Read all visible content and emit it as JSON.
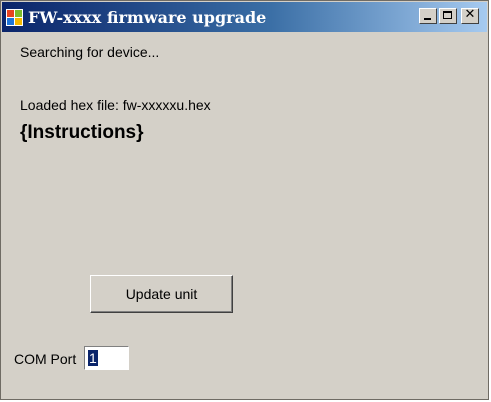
{
  "window": {
    "title": "FW-xxxx firmware upgrade",
    "title_icon": "app-window-icon",
    "controls": {
      "minimize_icon": "minimize-icon",
      "maximize_icon": "maximize-icon",
      "close_icon": "close-icon",
      "close_glyph": "✕"
    }
  },
  "main": {
    "status_text": "Searching for device...",
    "hex_file_text": "Loaded hex file: fw-xxxxxu.hex",
    "instructions": "{Instructions}",
    "update_button_label": "Update unit",
    "com_port_label": "COM Port",
    "com_port_value": "1"
  },
  "colors": {
    "dialog_background": "#d4d0c8",
    "title_gradient_start": "#0a246a",
    "title_gradient_end": "#a6caf0",
    "selection": "#0a246a"
  }
}
